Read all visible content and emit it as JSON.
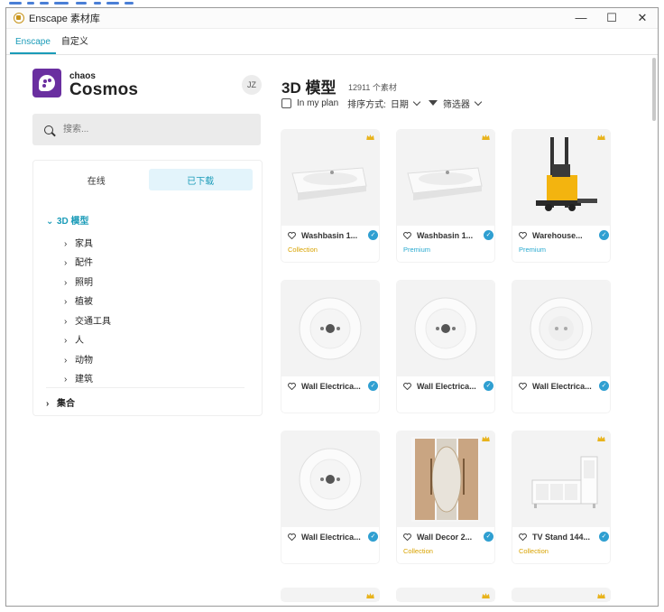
{
  "window": {
    "title": "Enscape 素材库",
    "controls": {
      "minimize": "—",
      "maximize": "☐",
      "close": "✕"
    }
  },
  "tabs": [
    {
      "label": "Enscape",
      "active": true
    },
    {
      "label": "自定义",
      "active": false
    }
  ],
  "brand": {
    "small": "chaos",
    "big": "Cosmos",
    "color": "#6a2fa0",
    "icon": "cosmos-logo-icon"
  },
  "user": {
    "initials": "JZ"
  },
  "search": {
    "placeholder": "搜索..."
  },
  "segment": {
    "online": "在线",
    "downloaded": "已下载",
    "selected": "downloaded"
  },
  "categories": {
    "root": {
      "label": "3D 模型",
      "expanded": true
    },
    "items": [
      "家具",
      "配件",
      "照明",
      "植被",
      "交通工具",
      "人",
      "动物",
      "建筑"
    ],
    "collection": "集合"
  },
  "main": {
    "heading": "3D 模型",
    "count": "12911 个素材",
    "in_my_plan": "In my plan",
    "sort_label": "排序方式:",
    "sort_value": "日期",
    "filter_label": "筛选器"
  },
  "assets": [
    {
      "name": "Washbasin 1...",
      "tag": "Collection",
      "tag_type": "collection",
      "premium_crown": true,
      "icon": "washbasin"
    },
    {
      "name": "Washbasin 1...",
      "tag": "Premium",
      "tag_type": "premium",
      "premium_crown": true,
      "icon": "washbasin"
    },
    {
      "name": "Warehouse...",
      "tag": "Premium",
      "tag_type": "premium",
      "premium_crown": true,
      "icon": "forklift"
    },
    {
      "name": "Wall Electrica...",
      "tag": "",
      "tag_type": "",
      "premium_crown": false,
      "icon": "wall-switch"
    },
    {
      "name": "Wall Electrica...",
      "tag": "",
      "tag_type": "",
      "premium_crown": false,
      "icon": "wall-switch"
    },
    {
      "name": "Wall Electrica...",
      "tag": "",
      "tag_type": "",
      "premium_crown": false,
      "icon": "wall-socket"
    },
    {
      "name": "Wall Electrica...",
      "tag": "",
      "tag_type": "",
      "premium_crown": false,
      "icon": "wall-switch"
    },
    {
      "name": "Wall Decor 2...",
      "tag": "Collection",
      "tag_type": "collection",
      "premium_crown": true,
      "icon": "wall-decor"
    },
    {
      "name": "TV Stand 144...",
      "tag": "Collection",
      "tag_type": "collection",
      "premium_crown": true,
      "icon": "tv-stand"
    }
  ],
  "colors": {
    "accent": "#1a9bb8",
    "crown": "#e8b31c",
    "verified": "#2f9fd1",
    "collection": "#d9a300",
    "premium": "#29aad0"
  }
}
